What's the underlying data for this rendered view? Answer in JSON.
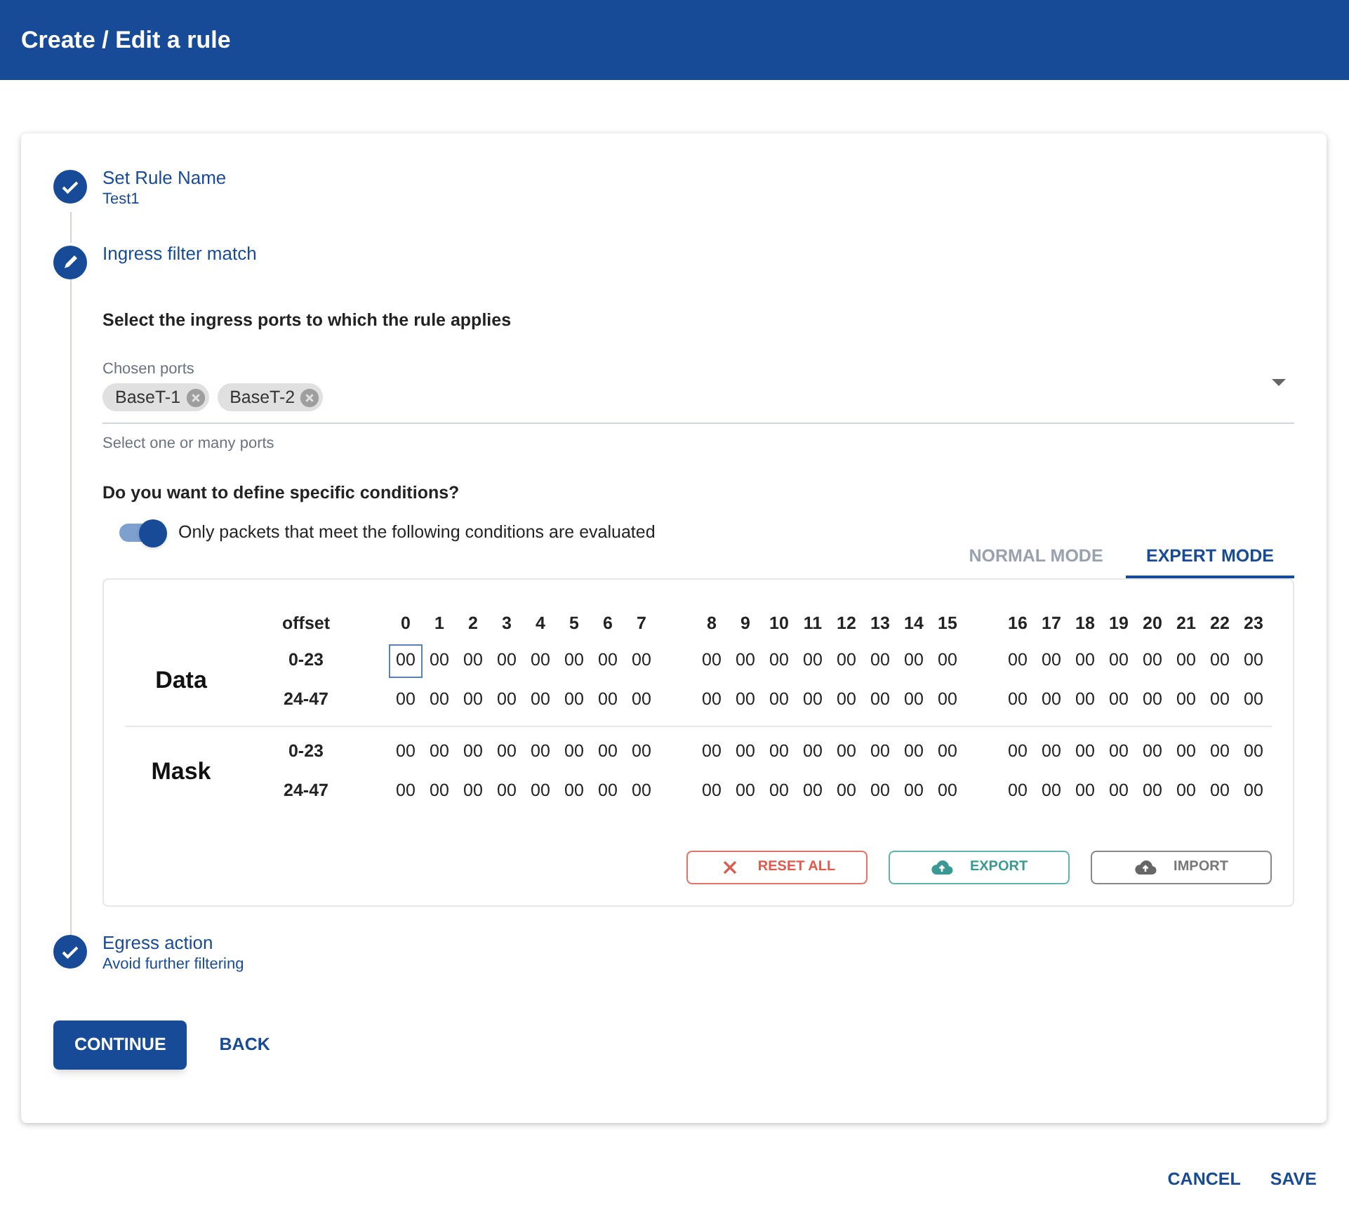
{
  "window": {
    "title": "Create / Edit a rule"
  },
  "steps": [
    {
      "kind": "done",
      "title": "Set Rule Name",
      "subtitle": "Test1"
    },
    {
      "kind": "edit",
      "title": "Ingress filter match"
    },
    {
      "kind": "done",
      "title": "Egress action",
      "subtitle": "Avoid further filtering"
    }
  ],
  "ports": {
    "heading": "Select the ingress ports to which the rule applies",
    "label": "Chosen ports",
    "chips": [
      "BaseT-1",
      "BaseT-2"
    ],
    "helper": "Select one or many ports"
  },
  "conditions": {
    "heading": "Do you want to define specific conditions?",
    "toggle": {
      "on": true,
      "label": "Only packets that meet the following conditions are evaluated"
    }
  },
  "mode_tabs": [
    {
      "label": "NORMAL MODE",
      "selected": false
    },
    {
      "label": "EXPERT MODE",
      "selected": true
    }
  ],
  "matrix": {
    "offset_header": "offset",
    "columns": [
      "0",
      "1",
      "2",
      "3",
      "4",
      "5",
      "6",
      "7",
      "8",
      "9",
      "10",
      "11",
      "12",
      "13",
      "14",
      "15",
      "16",
      "17",
      "18",
      "19",
      "20",
      "21",
      "22",
      "23"
    ],
    "sections": [
      {
        "label": "Data",
        "rows": [
          {
            "offset": "0-23",
            "cells": [
              {
                "value": "00",
                "selected": true
              },
              {
                "value": "00",
                "selected": false
              },
              {
                "value": "00",
                "selected": false
              },
              {
                "value": "00",
                "selected": false
              },
              {
                "value": "00",
                "selected": false
              },
              {
                "value": "00",
                "selected": false
              },
              {
                "value": "00",
                "selected": false
              },
              {
                "value": "00",
                "selected": false
              },
              {
                "value": "00",
                "selected": false
              },
              {
                "value": "00",
                "selected": false
              },
              {
                "value": "00",
                "selected": false
              },
              {
                "value": "00",
                "selected": false
              },
              {
                "value": "00",
                "selected": false
              },
              {
                "value": "00",
                "selected": false
              },
              {
                "value": "00",
                "selected": false
              },
              {
                "value": "00",
                "selected": false
              },
              {
                "value": "00",
                "selected": false
              },
              {
                "value": "00",
                "selected": false
              },
              {
                "value": "00",
                "selected": false
              },
              {
                "value": "00",
                "selected": false
              },
              {
                "value": "00",
                "selected": false
              },
              {
                "value": "00",
                "selected": false
              },
              {
                "value": "00",
                "selected": false
              },
              {
                "value": "00",
                "selected": false
              }
            ]
          },
          {
            "offset": "24-47",
            "cells": [
              {
                "value": "00",
                "selected": false
              },
              {
                "value": "00",
                "selected": false
              },
              {
                "value": "00",
                "selected": false
              },
              {
                "value": "00",
                "selected": false
              },
              {
                "value": "00",
                "selected": false
              },
              {
                "value": "00",
                "selected": false
              },
              {
                "value": "00",
                "selected": false
              },
              {
                "value": "00",
                "selected": false
              },
              {
                "value": "00",
                "selected": false
              },
              {
                "value": "00",
                "selected": false
              },
              {
                "value": "00",
                "selected": false
              },
              {
                "value": "00",
                "selected": false
              },
              {
                "value": "00",
                "selected": false
              },
              {
                "value": "00",
                "selected": false
              },
              {
                "value": "00",
                "selected": false
              },
              {
                "value": "00",
                "selected": false
              },
              {
                "value": "00",
                "selected": false
              },
              {
                "value": "00",
                "selected": false
              },
              {
                "value": "00",
                "selected": false
              },
              {
                "value": "00",
                "selected": false
              },
              {
                "value": "00",
                "selected": false
              },
              {
                "value": "00",
                "selected": false
              },
              {
                "value": "00",
                "selected": false
              },
              {
                "value": "00",
                "selected": false
              }
            ]
          }
        ]
      },
      {
        "label": "Mask",
        "rows": [
          {
            "offset": "0-23",
            "cells": [
              {
                "value": "00",
                "selected": false
              },
              {
                "value": "00",
                "selected": false
              },
              {
                "value": "00",
                "selected": false
              },
              {
                "value": "00",
                "selected": false
              },
              {
                "value": "00",
                "selected": false
              },
              {
                "value": "00",
                "selected": false
              },
              {
                "value": "00",
                "selected": false
              },
              {
                "value": "00",
                "selected": false
              },
              {
                "value": "00",
                "selected": false
              },
              {
                "value": "00",
                "selected": false
              },
              {
                "value": "00",
                "selected": false
              },
              {
                "value": "00",
                "selected": false
              },
              {
                "value": "00",
                "selected": false
              },
              {
                "value": "00",
                "selected": false
              },
              {
                "value": "00",
                "selected": false
              },
              {
                "value": "00",
                "selected": false
              },
              {
                "value": "00",
                "selected": false
              },
              {
                "value": "00",
                "selected": false
              },
              {
                "value": "00",
                "selected": false
              },
              {
                "value": "00",
                "selected": false
              },
              {
                "value": "00",
                "selected": false
              },
              {
                "value": "00",
                "selected": false
              },
              {
                "value": "00",
                "selected": false
              },
              {
                "value": "00",
                "selected": false
              }
            ]
          },
          {
            "offset": "24-47",
            "cells": [
              {
                "value": "00",
                "selected": false
              },
              {
                "value": "00",
                "selected": false
              },
              {
                "value": "00",
                "selected": false
              },
              {
                "value": "00",
                "selected": false
              },
              {
                "value": "00",
                "selected": false
              },
              {
                "value": "00",
                "selected": false
              },
              {
                "value": "00",
                "selected": false
              },
              {
                "value": "00",
                "selected": false
              },
              {
                "value": "00",
                "selected": false
              },
              {
                "value": "00",
                "selected": false
              },
              {
                "value": "00",
                "selected": false
              },
              {
                "value": "00",
                "selected": false
              },
              {
                "value": "00",
                "selected": false
              },
              {
                "value": "00",
                "selected": false
              },
              {
                "value": "00",
                "selected": false
              },
              {
                "value": "00",
                "selected": false
              },
              {
                "value": "00",
                "selected": false
              },
              {
                "value": "00",
                "selected": false
              },
              {
                "value": "00",
                "selected": false
              },
              {
                "value": "00",
                "selected": false
              },
              {
                "value": "00",
                "selected": false
              },
              {
                "value": "00",
                "selected": false
              },
              {
                "value": "00",
                "selected": false
              },
              {
                "value": "00",
                "selected": false
              }
            ]
          }
        ]
      }
    ]
  },
  "matrix_buttons": [
    {
      "kind": "reset",
      "label": "RESET ALL"
    },
    {
      "kind": "export",
      "label": "EXPORT"
    },
    {
      "kind": "import",
      "label": "IMPORT"
    }
  ],
  "step_buttons": [
    {
      "kind": "primary",
      "label": "CONTINUE"
    },
    {
      "kind": "text",
      "label": "BACK"
    }
  ],
  "dialog_buttons": [
    "CANCEL",
    "SAVE"
  ]
}
